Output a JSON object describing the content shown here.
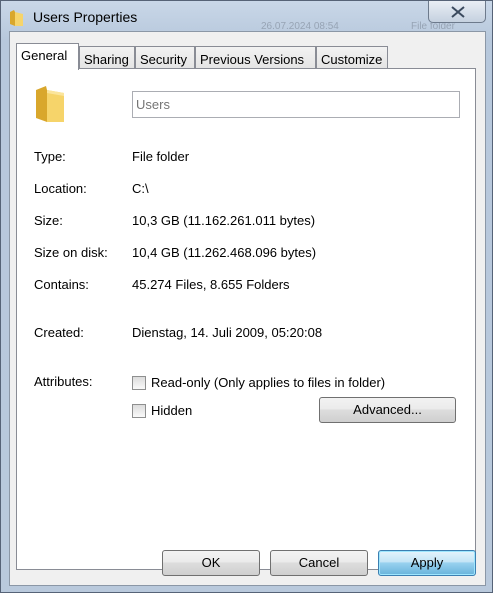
{
  "window": {
    "title": "Users Properties",
    "background_text": [
      "26.07.2024 08:54",
      "File folder"
    ]
  },
  "tabs": [
    {
      "label": "General",
      "active": true
    },
    {
      "label": "Sharing",
      "active": false
    },
    {
      "label": "Security",
      "active": false
    },
    {
      "label": "Previous Versions",
      "active": false
    },
    {
      "label": "Customize",
      "active": false
    }
  ],
  "general": {
    "name_placeholder": "Users",
    "properties": [
      {
        "label": "Type:",
        "value": "File folder"
      },
      {
        "label": "Location:",
        "value": "C:\\"
      },
      {
        "label": "Size:",
        "value": "10,3 GB (11.162.261.011 bytes)"
      },
      {
        "label": "Size on disk:",
        "value": "10,4 GB (11.262.468.096 bytes)"
      },
      {
        "label": "Contains:",
        "value": "45.274 Files, 8.655 Folders"
      }
    ],
    "created": {
      "label": "Created:",
      "value": "Dienstag, 14. Juli 2009, 05:20:08"
    },
    "attributes": {
      "label": "Attributes:",
      "readonly": {
        "label": "Read-only (Only applies to files in folder)",
        "checked": false
      },
      "hidden": {
        "label": "Hidden",
        "checked": false
      },
      "advanced_label": "Advanced..."
    }
  },
  "buttons": {
    "ok": "OK",
    "cancel": "Cancel",
    "apply": "Apply"
  },
  "colors": {
    "folder": "#f2c84b",
    "accent": "#3c7fb1"
  }
}
